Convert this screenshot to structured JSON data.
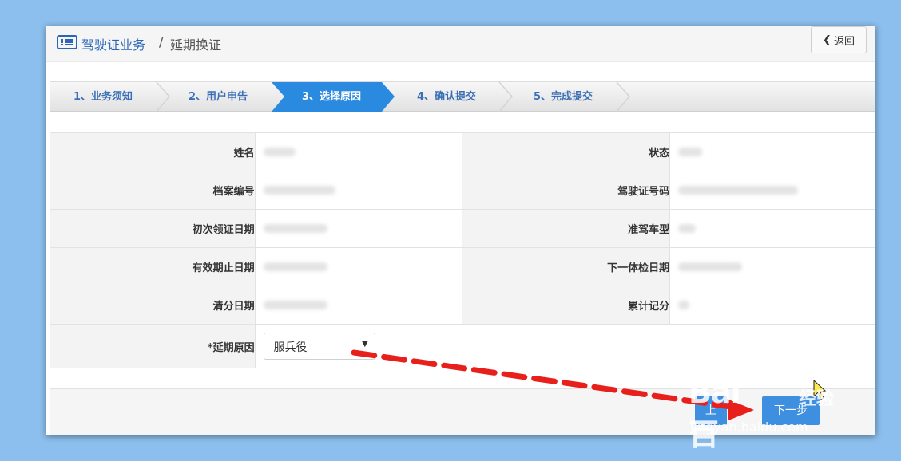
{
  "header": {
    "breadcrumb_main": "驾驶证业务",
    "breadcrumb_sep": "/",
    "breadcrumb_sub": "延期换证",
    "back_label": "返回"
  },
  "steps": [
    {
      "label": "1、业务须知",
      "active": false
    },
    {
      "label": "2、用户申告",
      "active": false
    },
    {
      "label": "3、选择原因",
      "active": true
    },
    {
      "label": "4、确认提交",
      "active": false
    },
    {
      "label": "5、完成提交",
      "active": false
    }
  ],
  "info_rows": [
    {
      "left_label": "姓名",
      "right_label": "状态"
    },
    {
      "left_label": "档案编号",
      "right_label": "驾驶证号码"
    },
    {
      "left_label": "初次领证日期",
      "right_label": "准驾车型"
    },
    {
      "left_label": "有效期止日期",
      "right_label": "下一体检日期"
    },
    {
      "left_label": "清分日期",
      "right_label": "累计记分"
    }
  ],
  "reason": {
    "label": "*延期原因",
    "selected": "服兵役"
  },
  "footer": {
    "prev_label": "上",
    "next_label": "下一步"
  },
  "watermark": {
    "logo": "Bai 百",
    "text": "经验",
    "url": "jingyan.baidu.com"
  },
  "colors": {
    "background": "#8cbfee",
    "accent": "#2a8ae0",
    "arrow": "#e8201c"
  }
}
